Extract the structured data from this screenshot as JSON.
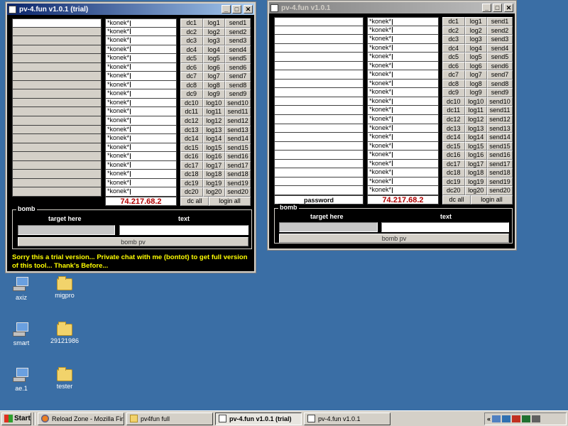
{
  "desktop": {
    "icons": [
      {
        "label": "axiz",
        "type": "exe"
      },
      {
        "label": "migpro",
        "type": "folder"
      },
      {
        "label": "smart",
        "type": "exe"
      },
      {
        "label": "29121986",
        "type": "folder"
      },
      {
        "label": "ae.1",
        "type": "exe"
      },
      {
        "label": "tester",
        "type": "folder"
      }
    ]
  },
  "window1": {
    "title": "pv-4.fun v1.0.1 (trial)",
    "rows": [
      {
        "msg": "*konek*",
        "dc": "dc1",
        "log": "log1",
        "send": "send1"
      },
      {
        "msg": "*konek*",
        "dc": "dc2",
        "log": "log2",
        "send": "send2"
      },
      {
        "msg": "*konek*",
        "dc": "dc3",
        "log": "log3",
        "send": "send3"
      },
      {
        "msg": "*konek*",
        "dc": "dc4",
        "log": "log4",
        "send": "send4"
      },
      {
        "msg": "*konek*",
        "dc": "dc5",
        "log": "log5",
        "send": "send5"
      },
      {
        "msg": "*konek*",
        "dc": "dc6",
        "log": "log6",
        "send": "send6"
      },
      {
        "msg": "*konek*",
        "dc": "dc7",
        "log": "log7",
        "send": "send7"
      },
      {
        "msg": "*konek*",
        "dc": "dc8",
        "log": "log8",
        "send": "send8"
      },
      {
        "msg": "*konek*",
        "dc": "dc9",
        "log": "log9",
        "send": "send9"
      },
      {
        "msg": "*konek*",
        "dc": "dc10",
        "log": "log10",
        "send": "send10"
      },
      {
        "msg": "*konek*",
        "dc": "dc11",
        "log": "log11",
        "send": "send11"
      },
      {
        "msg": "*konek*",
        "dc": "dc12",
        "log": "log12",
        "send": "send12"
      },
      {
        "msg": "*konek*",
        "dc": "dc13",
        "log": "log13",
        "send": "send13"
      },
      {
        "msg": "*konek*",
        "dc": "dc14",
        "log": "log14",
        "send": "send14"
      },
      {
        "msg": "*konek*",
        "dc": "dc15",
        "log": "log15",
        "send": "send15"
      },
      {
        "msg": "*konek*",
        "dc": "dc16",
        "log": "log16",
        "send": "send16"
      },
      {
        "msg": "*konek*",
        "dc": "dc17",
        "log": "log17",
        "send": "send17"
      },
      {
        "msg": "*konek*",
        "dc": "dc18",
        "log": "log18",
        "send": "send18"
      },
      {
        "msg": "*konek*",
        "dc": "dc19",
        "log": "log19",
        "send": "send19"
      },
      {
        "msg": "*konek*",
        "dc": "dc20",
        "log": "log20",
        "send": "send20"
      }
    ],
    "ip": "74.217.68.2",
    "dc_all": "dc all",
    "login_all": "login all",
    "bomb": {
      "legend": "bomb",
      "target_label": "target here",
      "text_label": "text",
      "button": "bomb pv"
    },
    "trial_notice": "Sorry this a trial version... Private chat with me (bontot) to get full version of this tool... Thank's Before..."
  },
  "window2": {
    "title": "pv-4.fun v1.0.1",
    "password_label": "password",
    "ip": "74.217.68.2",
    "dc_all": "dc all",
    "login_all": "login all",
    "bomb": {
      "legend": "bomb",
      "target_label": "target here",
      "text_label": "text",
      "button": "bomb pv"
    }
  },
  "taskbar": {
    "start": "Start",
    "tasks": [
      {
        "label": "Reload Zone - Mozilla Fir...",
        "icon": "firefox-icon"
      },
      {
        "label": "pv4fun full",
        "icon": "folder-icon"
      },
      {
        "label": "pv-4.fun v1.0.1 (trial)",
        "icon": "app-icon",
        "active": true
      },
      {
        "label": "pv-4.fun v1.0.1",
        "icon": "app-icon"
      }
    ]
  }
}
